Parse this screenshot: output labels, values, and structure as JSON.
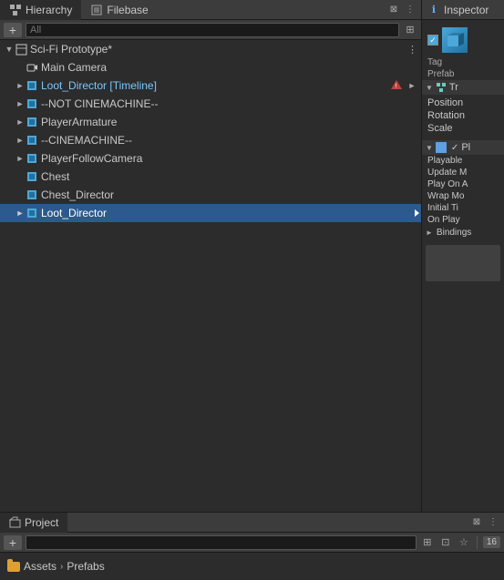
{
  "panels": {
    "hierarchy": {
      "tab_label": "Hierarchy",
      "filebase_label": "Filebase",
      "search_placeholder": "All"
    },
    "inspector": {
      "tab_label": "Inspector",
      "tag_label": "Tag",
      "prefab_label": "Prefab",
      "transform": {
        "section_label": "Tr",
        "position_label": "Position",
        "rotation_label": "Rotation",
        "scale_label": "Scale"
      },
      "playable_director": {
        "section_label": "Pl",
        "playable_label": "Playable",
        "update_mode_label": "Update M",
        "play_on_awake_label": "Play On A",
        "wrap_mode_label": "Wrap Mo",
        "initial_time_label": "Initial Ti",
        "on_play_label": "On Play",
        "bindings_label": "Bindings"
      }
    },
    "project": {
      "tab_label": "Project",
      "badge_count": "16",
      "breadcrumb": [
        "Assets",
        "Prefabs"
      ]
    }
  },
  "hierarchy_items": [
    {
      "id": "sci_fi",
      "label": "Sci-Fi Prototype*",
      "indent": 0,
      "expand": "expanded",
      "icon": "scene",
      "selected": false,
      "has_menu": true
    },
    {
      "id": "main_camera",
      "label": "Main Camera",
      "indent": 1,
      "expand": "none",
      "icon": "camera",
      "selected": false
    },
    {
      "id": "loot_director_timeline",
      "label": "Loot_Director [Timeline]",
      "indent": 1,
      "expand": "collapsed",
      "icon": "cube",
      "selected": false,
      "is_timeline": true,
      "has_warning": true
    },
    {
      "id": "not_cinemachine",
      "label": "--NOT CINEMACHINE--",
      "indent": 1,
      "expand": "collapsed",
      "icon": "cube",
      "selected": false
    },
    {
      "id": "player_armature",
      "label": "PlayerArmature",
      "indent": 1,
      "expand": "collapsed",
      "icon": "cube",
      "selected": false
    },
    {
      "id": "cinemachine",
      "label": "--CINEMACHINE--",
      "indent": 1,
      "expand": "collapsed",
      "icon": "cube",
      "selected": false
    },
    {
      "id": "player_follow_camera",
      "label": "PlayerFollowCamera",
      "indent": 1,
      "expand": "collapsed",
      "icon": "cube",
      "selected": false
    },
    {
      "id": "chest",
      "label": "Chest",
      "indent": 1,
      "expand": "none",
      "icon": "cube",
      "selected": false
    },
    {
      "id": "chest_director",
      "label": "Chest_Director",
      "indent": 1,
      "expand": "none",
      "icon": "cube",
      "selected": false
    },
    {
      "id": "loot_director",
      "label": "Loot_Director",
      "indent": 1,
      "expand": "collapsed",
      "icon": "cube",
      "selected": true,
      "has_arrow_right": true
    }
  ],
  "icons": {
    "scene": "🎬",
    "camera": "📷",
    "cube_color": "#4ca8d8",
    "info": "ℹ",
    "add": "+",
    "search": "🔍",
    "gear": "⚙",
    "dots": "⋮",
    "warning": "⚠",
    "check": "✓",
    "arrow_down": "▼",
    "arrow_right": "►"
  }
}
